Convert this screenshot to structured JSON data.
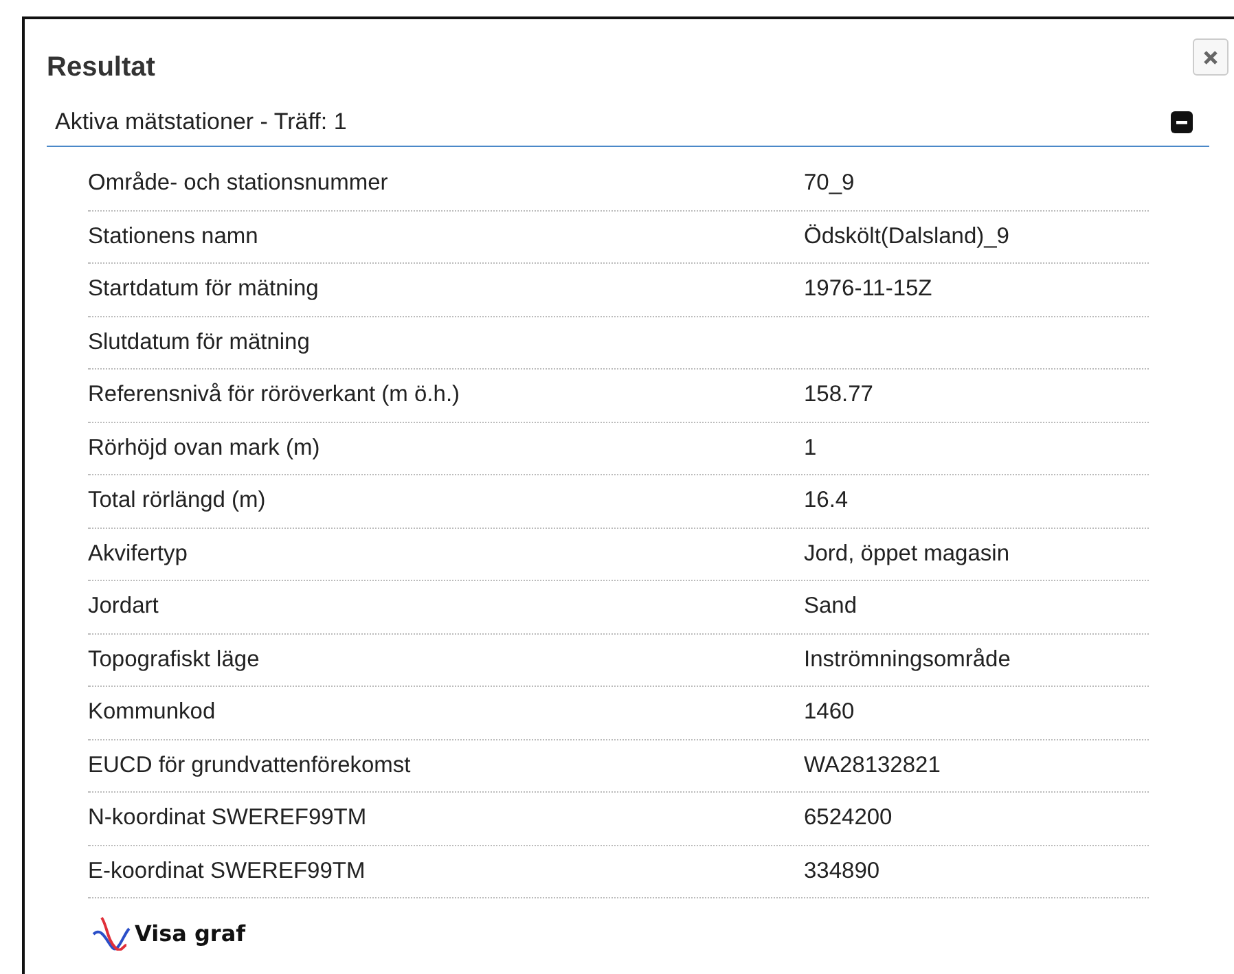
{
  "dialog": {
    "title": "Resultat"
  },
  "section": {
    "title": "Aktiva mätstationer - Träff: 1",
    "expanded": true,
    "rows": [
      {
        "label": "Område- och stationsnummer",
        "value": "70_9"
      },
      {
        "label": "Stationens namn",
        "value": "Ödskölt(Dalsland)_9"
      },
      {
        "label": "Startdatum för mätning",
        "value": "1976-11-15Z"
      },
      {
        "label": "Slutdatum för mätning"
      },
      {
        "label": "Referensnivå för röröverkant (m ö.h.)",
        "value": "158.77"
      },
      {
        "label": "Rörhöjd ovan mark (m)",
        "value": "1"
      },
      {
        "label": "Total rörlängd (m)",
        "value": "16.4"
      },
      {
        "label": "Akvifertyp",
        "value": "Jord, öppet magasin"
      },
      {
        "label": "Jordart",
        "value": "Sand"
      },
      {
        "label": "Topografiskt läge",
        "value": "Inströmningsområde"
      },
      {
        "label": "Kommunkod",
        "value": "1460"
      },
      {
        "label": "EUCD för grundvattenförekomst",
        "value": "WA28132821"
      },
      {
        "label": "N-koordinat SWEREF99TM",
        "value": "6524200"
      },
      {
        "label": "E-koordinat SWEREF99TM",
        "value": "334890"
      }
    ],
    "link": "Visa graf"
  }
}
